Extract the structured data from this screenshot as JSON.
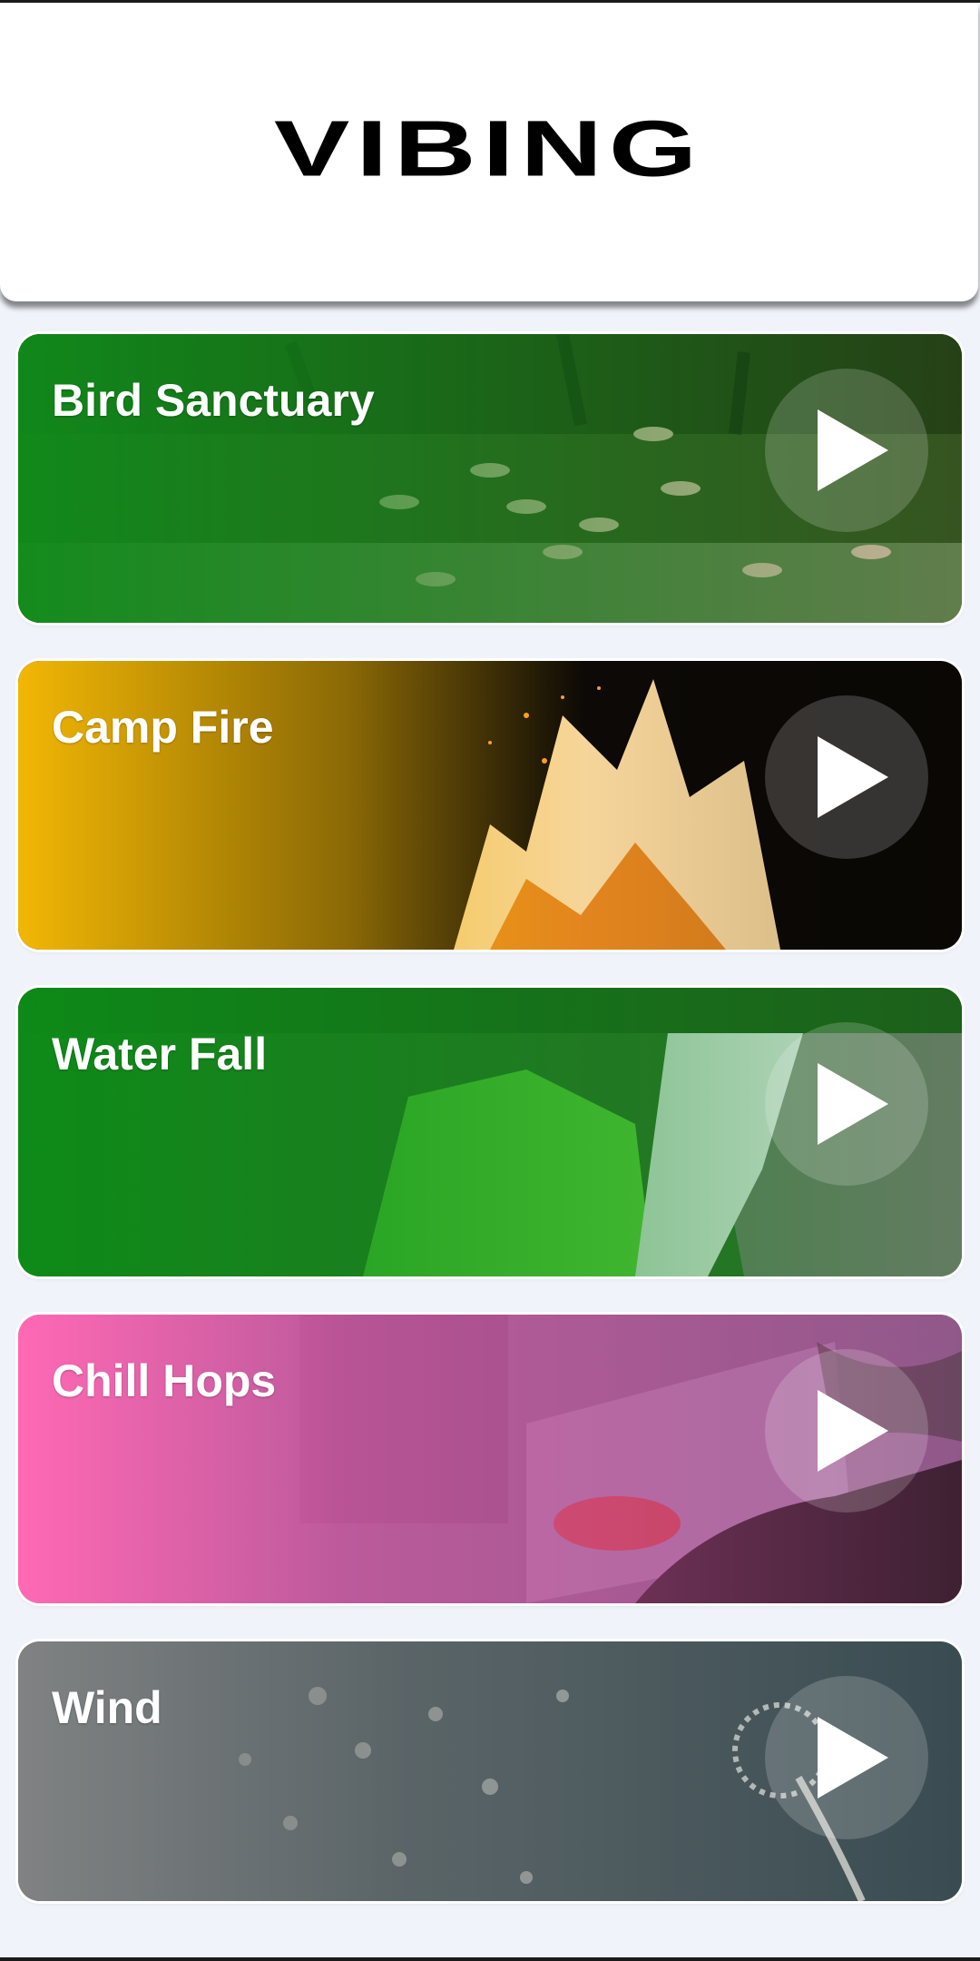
{
  "app": {
    "logo_text": "VIBING"
  },
  "colors": {
    "background": "#f1f3fb",
    "bird_sanctuary": "#0f8c1a",
    "camp_fire": "#f2b705",
    "water_fall": "#0c8c17",
    "chill_hops": "#ff69b4",
    "wind": "#808283"
  },
  "cards": [
    {
      "title": "Bird Sanctuary",
      "icon": "play-icon"
    },
    {
      "title": "Camp Fire",
      "icon": "play-icon"
    },
    {
      "title": "Water Fall",
      "icon": "play-icon"
    },
    {
      "title": "Chill Hops",
      "icon": "play-icon"
    },
    {
      "title": "Wind",
      "icon": "play-icon"
    }
  ]
}
